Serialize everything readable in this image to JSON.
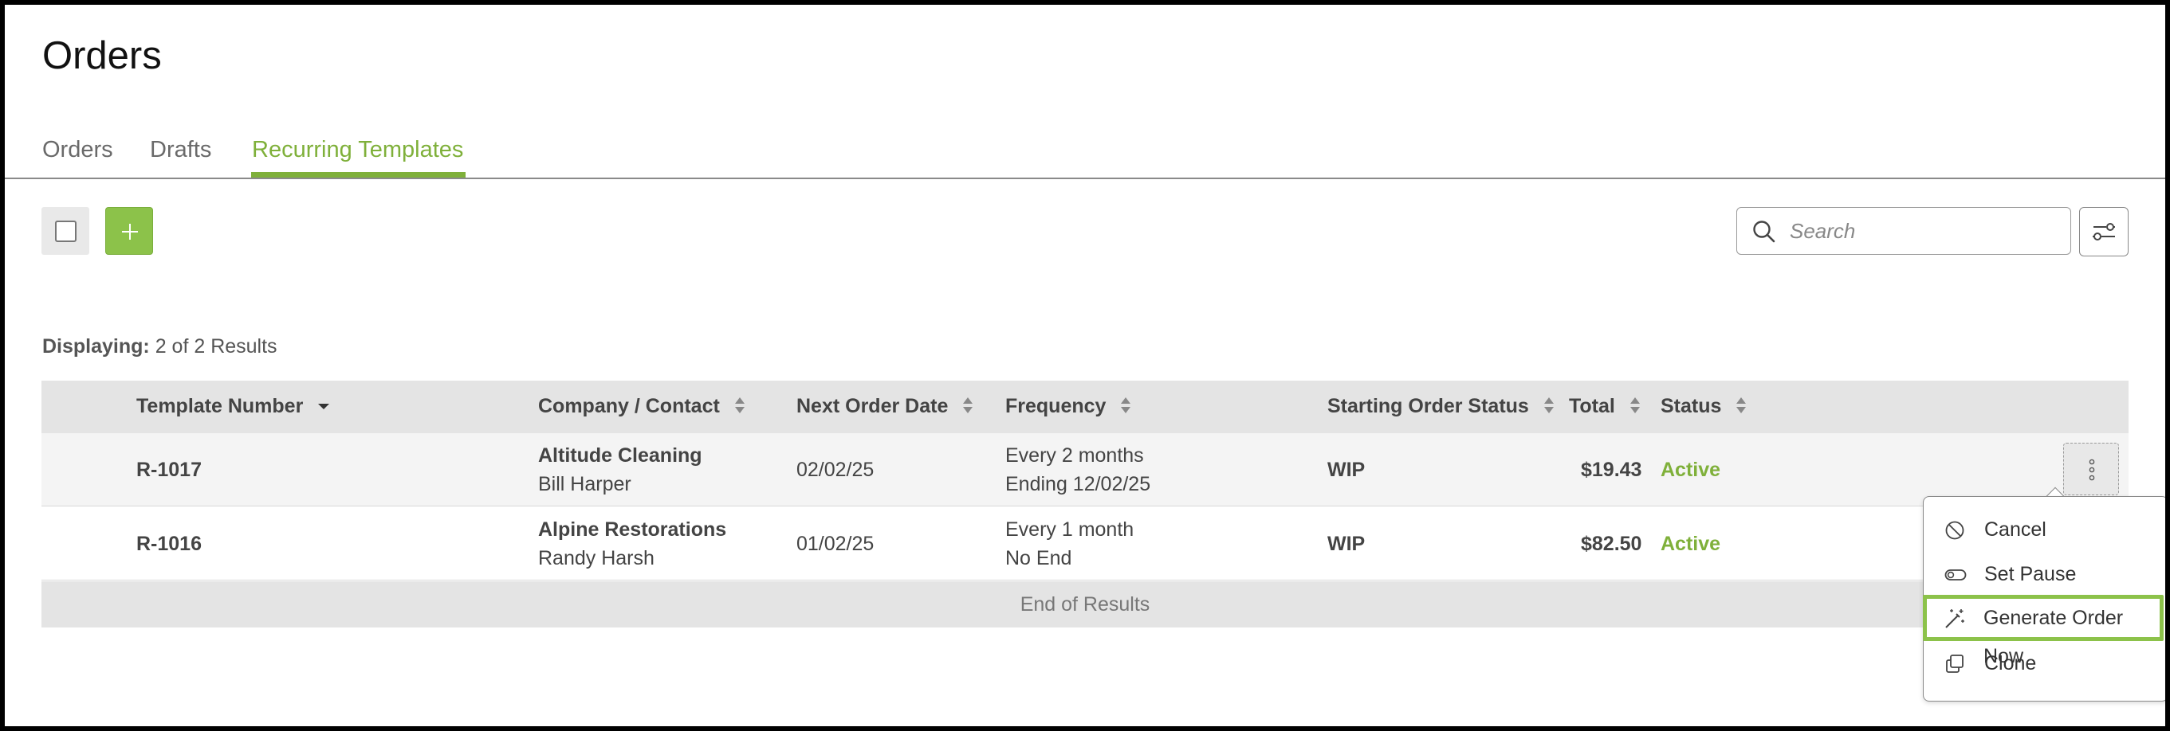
{
  "page": {
    "title": "Orders"
  },
  "tabs": [
    {
      "label": "Orders",
      "active": false
    },
    {
      "label": "Drafts",
      "active": false
    },
    {
      "label": "Recurring Templates",
      "active": true
    }
  ],
  "toolbar": {
    "add_icon": "plus-icon",
    "search_placeholder": "Search",
    "search_value": "",
    "filter_icon": "sliders-icon"
  },
  "results": {
    "label": "Displaying:",
    "count_text": "2 of 2 Results"
  },
  "table": {
    "headers": [
      "Template Number",
      "Company / Contact",
      "Next Order Date",
      "Frequency",
      "Starting Order Status",
      "Total",
      "Status"
    ],
    "rows": [
      {
        "template_number": "R-1017",
        "company": "Altitude Cleaning",
        "contact": "Bill Harper",
        "next_order_date": "02/02/25",
        "frequency": "Every 2 months",
        "frequency_end": "Ending 12/02/25",
        "starting_status": "WIP",
        "total": "$19.43",
        "status": "Active"
      },
      {
        "template_number": "R-1016",
        "company": "Alpine Restorations",
        "contact": "Randy Harsh",
        "next_order_date": "01/02/25",
        "frequency": "Every 1 month",
        "frequency_end": "No End",
        "starting_status": "WIP",
        "total": "$82.50",
        "status": "Active"
      }
    ],
    "end_text": "End of Results"
  },
  "context_menu": {
    "items": [
      {
        "label": "Cancel",
        "icon": "ban-icon"
      },
      {
        "label": "Set Pause",
        "icon": "toggle-icon"
      },
      {
        "label": "Generate Order Now",
        "icon": "magic-wand-icon",
        "highlighted": true
      },
      {
        "label": "Clone",
        "icon": "copy-icon"
      }
    ]
  },
  "colors": {
    "accent": "#7fb03a",
    "add_button": "#8cc24a",
    "header_bg": "#e4e4e4"
  }
}
